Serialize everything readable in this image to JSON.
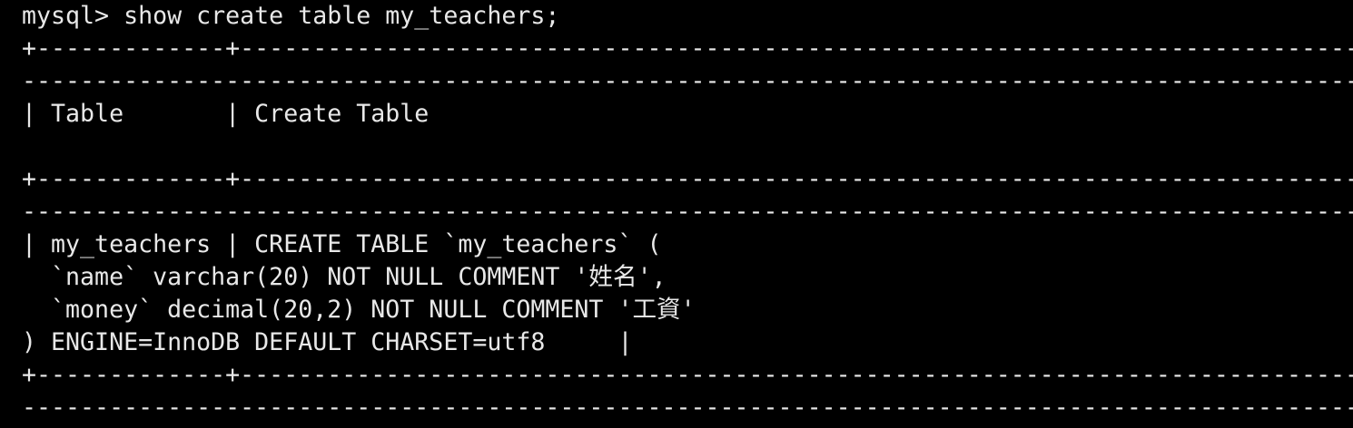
{
  "terminal": {
    "lines": [
      "mysql> show create table my_teachers;",
      "+-------------+-------------------------------------------------------------------------------------------------------------------",
      "------------------------------------------------------------------------------------------------------------------------------------------------------+",
      "| Table       | Create Table",
      "                                                                                                                                                     |",
      "+-------------+-------------------------------------------------------------------------------------------------------------------",
      "------------------------------------------------------------------------------------------------------------------------------------------------------+",
      "| my_teachers | CREATE TABLE `my_teachers` (",
      "  `name` varchar(20) NOT NULL COMMENT '姓名',",
      "  `money` decimal(20,2) NOT NULL COMMENT '工資'",
      ") ENGINE=InnoDB DEFAULT CHARSET=utf8     |",
      "+-------------+-------------------------------------------------------------------------------------------------------------------",
      "------------------------------------------------------------------------------------------------------------------------------------------------------+"
    ]
  }
}
